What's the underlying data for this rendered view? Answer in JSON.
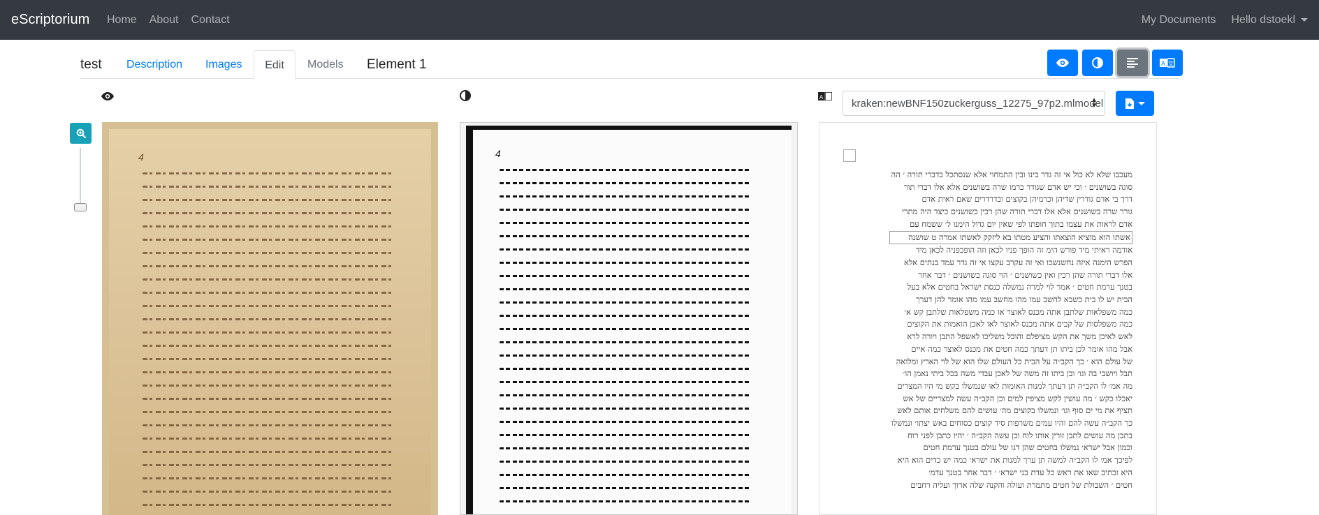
{
  "navbar": {
    "brand": "eScriptorium",
    "links": [
      "Home",
      "About",
      "Contact"
    ],
    "my_documents": "My Documents",
    "user": "Hello dstoekl"
  },
  "tabs": {
    "title": "test",
    "description": "Description",
    "images": "Images",
    "edit": "Edit",
    "models": "Models",
    "element": "Element 1"
  },
  "toolbar": {
    "icons": [
      "eye-icon",
      "contrast-icon",
      "align-lines-icon",
      "translate-icon"
    ],
    "active": "align-lines-icon"
  },
  "colors": {
    "primary": "#007bff",
    "navbar": "#343a40",
    "info": "#17a2b8",
    "secondary": "#6c757d"
  },
  "image_panel": {
    "folio": "4"
  },
  "binarized_panel": {
    "folio": "4"
  },
  "transcription": {
    "model": "kraken:newBNF150zuckerguss_12275_97p2.mlmodel",
    "lines": [
      "מעכבו שלא לא כול אי זה גדר בינו ובין התמחוי אלא שנסתכל בדברי תורה ׳ הה",
      "סוגה בשושנים ׳ וכי יש אדם שגודר כרמו שרה בשושנים אלא אלו דברי תור",
      "דרך בי אדם גודרין שדיהן וכרמיהן בקוצים ובדרדרים שאם ראית אדם",
      "גורר שרה בשושנים אלא אלו דברי תורה שהן רכין כשושנים כיצד היה מתרי",
      "אדם לראות את עצמו בתוך חופתו לפי שאין יום גדול הימנו ל׳ ששמח עם",
      "אשתו הוא מוציא הוצאתו והציע מטתו בא ליזקק לאשתו אמרה ט שושנה",
      "אודמה ראיתי מיד פורש הימ זה הופך פניו לכאן וזה הופכפניה לכאן מיד",
      "הפרש הימנה איזה נחשנשכו ואי זה עקרב עקצו אי זה גדר עמד בנתים אלא",
      "אלו דברי תורה שהן רכין ואין כשושנים ׳ הוי סוגה בשושנים ׳ דבר אחר",
      "בטנך ערמת חטים ׳ אמר לוי למרה נמשלה כנסת ישראל בחטים אלא בעל",
      "הבית יש לו בית כשבא לחשב עמו מהו מחשב עמו מהו אומר להן דערך",
      "כמה משפלאות שלתבן אתה מכנס לאוצר או כמה משפלאות שלתבן קש א׳",
      "כמה משפלסות של קבים אתה מכנס לאוצר לאו לאכן הואמות את הקוצים",
      "לאש לאיכן משך את הקש מציפלם והובל משליכו לאשפל התבן ויורה לרא",
      "אבל מהו אומר לכן ביתו תן דעתך כמה חטים את מכנס לאוצר כמה איים",
      "של עולם הוא ׳ כך הקב״ה על הבית כל העולם שלו הוא של לוי הארץ ומלואה",
      "תבל ויושבי בה וגו׳ ובן ביתו זה משה של לאכן עבדי משה בכל ביתי נאמן הו׳",
      "מה אמ׳ לו הקב״ה תן דעתך למנות האומות לאו שנמשלו בקש מי היו המצרים",
      "יאכלו כקש ׳ מה עושין לקש מציפין למים וכן הקב״ה עשה למצריים של אש",
      "תציף את מי ים סוף וגו׳ ונמשלו בקוצים מה׳ עושים להם משלחים אותם לאש",
      "כך הקב״ה עשה להם והיו עמים משרפות סיד קוצים כסוחים באש יצתו׳ ונמשלו",
      "בתבן מה עושים לתבן זורין אותו לוח וכן עשה הקב״ה ׳ יהיו כתבן לפני רוח",
      "וכמון אבל ישרא׳ נמשלו בחטים שהן דגו של עולם בטנך ערמת חטים",
      "לפיכך אמ׳ לו הקב״ה למשה תן ערך למנות את ישרא׳ כמה יש כדים הוא היא",
      "היא זכתיב שאו את ראש כל עדת בני ישרא׳ ׳ דבר אחר בטנך עדמ׳",
      "חטים ׳ השבולת של חטים מתמרת ועולה והקנה שלה ארוך ועליה רחבים"
    ]
  }
}
